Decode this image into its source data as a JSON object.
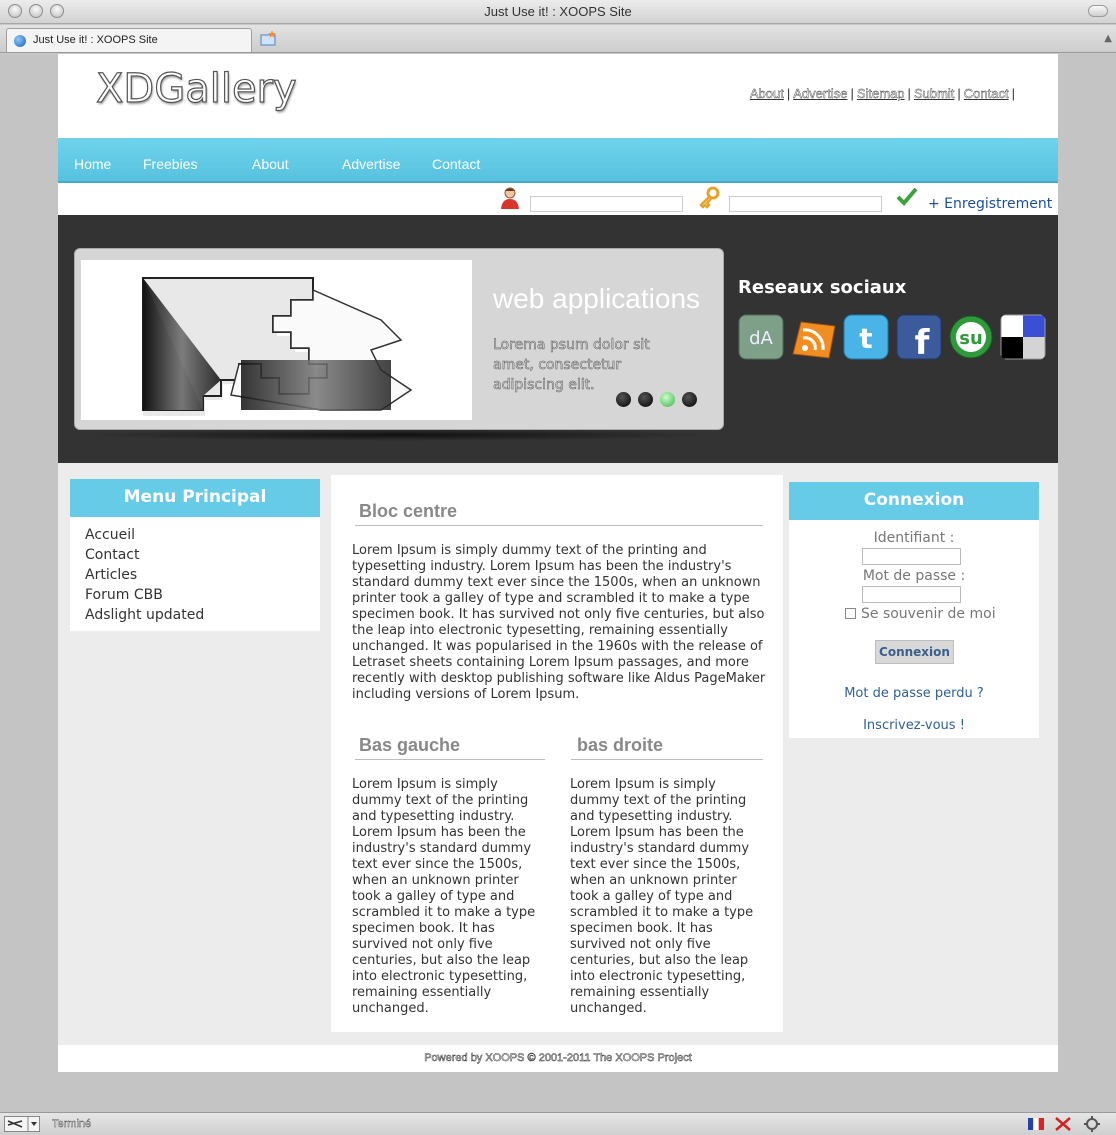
{
  "window": {
    "title": "Just Use it! : XOOPS Site"
  },
  "tab": {
    "title": "Just Use it! : XOOPS Site"
  },
  "site": {
    "logo": "XDGallery",
    "top_links": [
      "About",
      "Advertise",
      "Sitemap",
      "Submit",
      "Contact"
    ],
    "top_links_trailing": "|"
  },
  "nav": [
    "Home",
    "Freebies",
    "About",
    "Advertise",
    "Contact"
  ],
  "login_bar": {
    "register": "+ Enregistrement"
  },
  "slider": {
    "title": "web applications",
    "text": "Lorema psum dolor sit amet, consectetur adipiscing elit.",
    "slide_count": 4,
    "active_slide": 3
  },
  "social": {
    "title": "Reseaux sociaux",
    "icons": [
      "deviantart-icon",
      "rss-icon",
      "twitter-icon",
      "facebook-icon",
      "stumbleupon-icon",
      "delicious-icon"
    ]
  },
  "menu": {
    "title": "Menu Principal",
    "items": [
      "Accueil",
      "Contact",
      "Articles",
      "Forum CBB",
      "Adslight updated"
    ]
  },
  "center": {
    "bloc_title": "Bloc centre",
    "bloc_text": "Lorem Ipsum is simply dummy text of the printing and typesetting industry. Lorem Ipsum has been the industry's standard dummy text ever since the 1500s, when an unknown printer took a galley of type and scrambled it to make a type specimen book. It has survived not only five centuries, but also the leap into electronic typesetting, remaining essentially unchanged. It was popularised in the 1960s with the release of Letraset sheets containing Lorem Ipsum passages, and more recently with desktop publishing software like Aldus PageMaker including versions of Lorem Ipsum.",
    "left_title": "Bas gauche",
    "left_text": "Lorem Ipsum is simply dummy text of the printing and typesetting industry. Lorem Ipsum has been the industry's standard dummy text ever since the 1500s, when an unknown printer took a galley of type and scrambled it to make a type specimen book. It has survived not only five centuries, but also the leap into electronic typesetting, remaining essentially unchanged.",
    "right_title": "bas droite",
    "right_text": "Lorem Ipsum is simply dummy text of the printing and typesetting industry. Lorem Ipsum has been the industry's standard dummy text ever since the 1500s, when an unknown printer took a galley of type and scrambled it to make a type specimen book. It has survived not only five centuries, but also the leap into electronic typesetting, remaining essentially unchanged."
  },
  "login": {
    "title": "Connexion",
    "identifiant_label": "Identifiant :",
    "password_label": "Mot de passe :",
    "remember_label": "Se souvenir de moi",
    "remember_checked": false,
    "button": "Connexion",
    "lost_password": "Mot de passe perdu ?",
    "register": "Inscrivez-vous !"
  },
  "footer": {
    "text": "Powered by XOOPS © 2001-2011 The XOOPS Project"
  },
  "status": {
    "text": "Terminé"
  }
}
